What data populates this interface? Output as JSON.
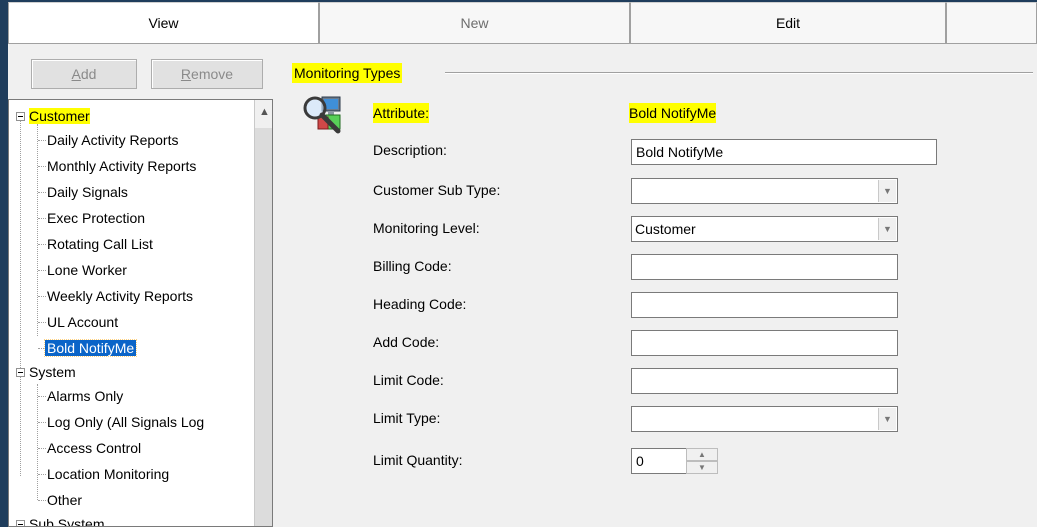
{
  "tabs": {
    "view": "View",
    "new": "New",
    "edit": "Edit"
  },
  "buttons": {
    "add_u": "A",
    "add_rest": "dd",
    "remove_u": "R",
    "remove_rest": "emove"
  },
  "tree": {
    "customer": "Customer",
    "customer_items": [
      "Daily Activity Reports",
      "Monthly Activity Reports",
      "Daily Signals",
      "Exec Protection",
      "Rotating Call List",
      "Lone Worker",
      "Weekly Activity Reports",
      "UL Account",
      "Bold NotifyMe"
    ],
    "system": "System",
    "system_items": [
      "Alarms Only",
      "Log Only (All Signals Log",
      "Access Control",
      "Location Monitoring",
      "Other"
    ],
    "sub_system": "Sub System"
  },
  "section": {
    "title": "Monitoring Types"
  },
  "form": {
    "attribute_label": "Attribute:",
    "attribute_value": "Bold NotifyMe",
    "description_label": "Description:",
    "description_value": "Bold NotifyMe",
    "customer_sub_type_label": "Customer Sub Type:",
    "customer_sub_type_value": "",
    "monitoring_level_label": "Monitoring Level:",
    "monitoring_level_value": "Customer",
    "billing_code_label": "Billing Code:",
    "billing_code_value": "",
    "heading_code_label": "Heading Code:",
    "heading_code_value": "",
    "add_code_label": "Add Code:",
    "add_code_value": "",
    "limit_code_label": "Limit Code:",
    "limit_code_value": "",
    "limit_type_label": "Limit Type:",
    "limit_type_value": "",
    "limit_quantity_label": "Limit Quantity:",
    "limit_quantity_value": "0"
  },
  "colors": {
    "highlight": "#ffff00",
    "selection": "#0a64c8",
    "frame": "#1f3d5c"
  }
}
